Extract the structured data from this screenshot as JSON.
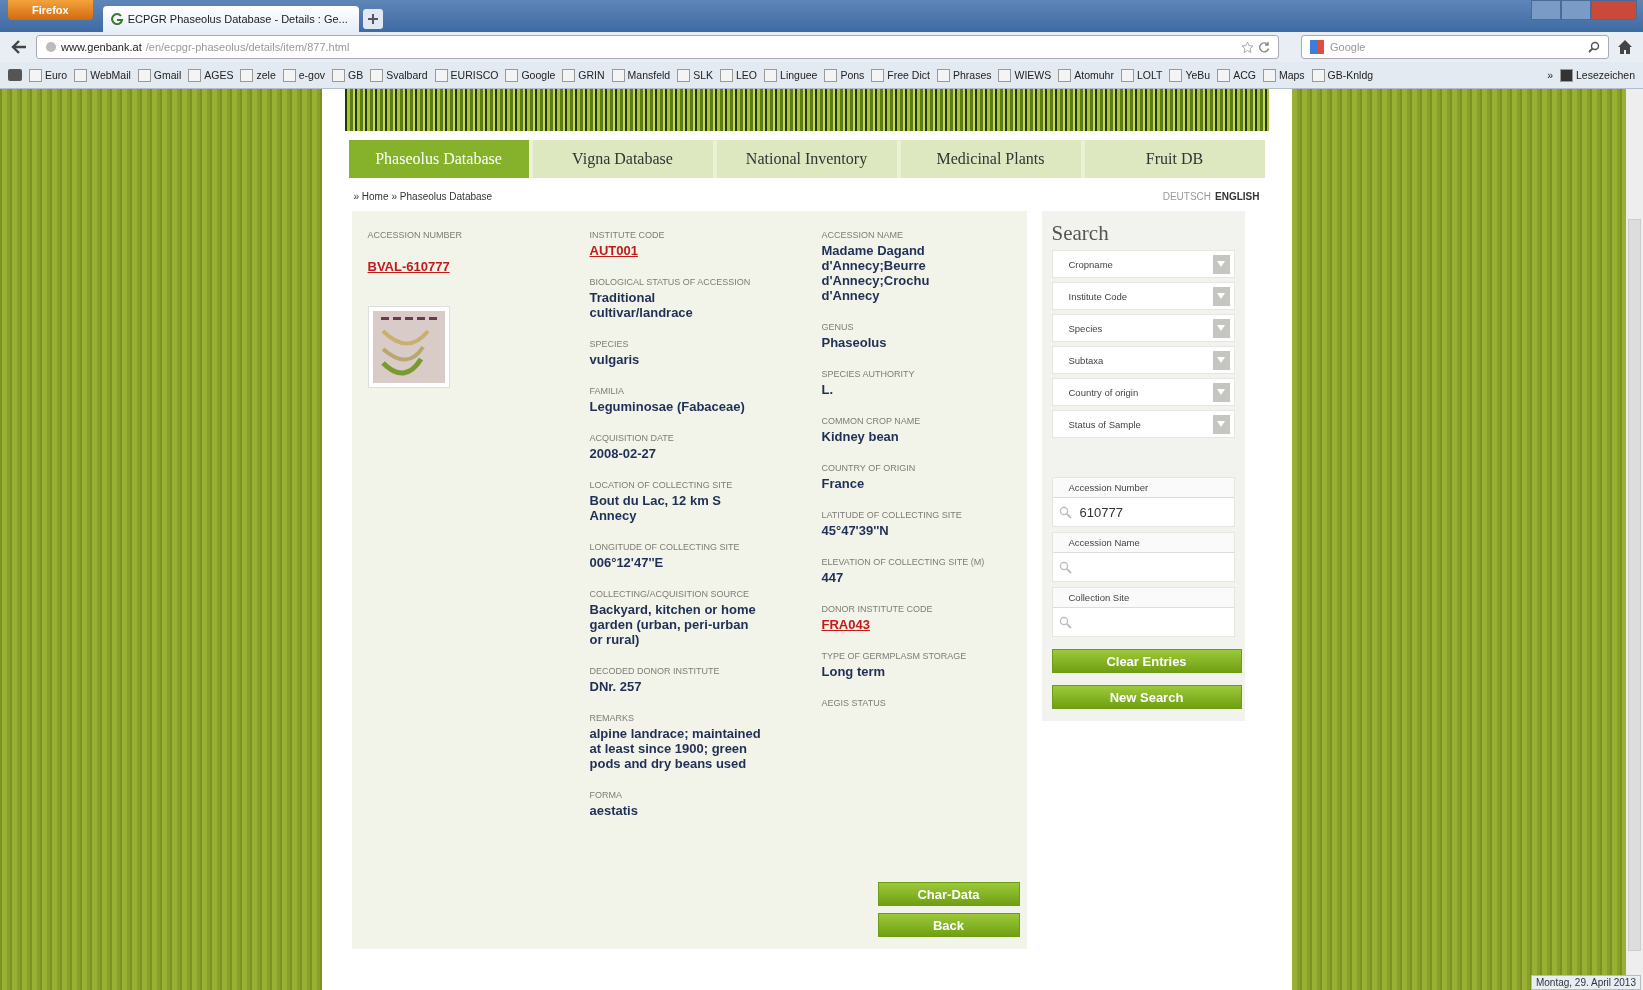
{
  "browser": {
    "menu_button": "Firefox",
    "tab_title": "ECPGR Phaseolus Database - Details : Ge...",
    "url_host": "www.genbank.at",
    "url_path": "/en/ecpgr-phaseolus/details/item/877.html",
    "search_placeholder": "Google",
    "bookmarks": [
      "Euro",
      "WebMail",
      "Gmail",
      "AGES",
      "zele",
      "e-gov",
      "GB",
      "Svalbard",
      "EURISCO",
      "Google",
      "GRIN",
      "Mansfeld",
      "SLK",
      "LEO",
      "Linguee",
      "Pons",
      "Free Dict",
      "Phrases",
      "WIEWS",
      "Atomuhr",
      "LOLT",
      "YeBu",
      "ACG",
      "Maps",
      "GB-Knldg"
    ],
    "bookmarks_overflow": "»",
    "bookmarks_folder": "Lesezeichen"
  },
  "nav_tabs": [
    {
      "label": "Phaseolus Database",
      "selected": true
    },
    {
      "label": "Vigna Database",
      "selected": false
    },
    {
      "label": "National Inventory",
      "selected": false
    },
    {
      "label": "Medicinal Plants",
      "selected": false
    },
    {
      "label": "Fruit DB",
      "selected": false
    }
  ],
  "breadcrumb": [
    "» Home",
    "» Phaseolus Database"
  ],
  "languages": [
    {
      "label": "DEUTSCH",
      "selected": false
    },
    {
      "label": "ENGLISH",
      "selected": true
    }
  ],
  "accession": {
    "label": "ACCESSION NUMBER",
    "value": "BVAL-610777"
  },
  "columns": [
    [
      {
        "label": "INSTITUTE CODE",
        "value": "AUT001",
        "kind": "link"
      },
      {
        "label": "BIOLOGICAL STATUS OF ACCESSION",
        "value": "Traditional cultivar/landrace",
        "kind": "text"
      },
      {
        "label": "SPECIES",
        "value": "vulgaris",
        "kind": "text"
      },
      {
        "label": "FAMILIA",
        "value": "Leguminosae (Fabaceae)",
        "kind": "text"
      },
      {
        "label": "ACQUISITION DATE",
        "value": "2008-02-27",
        "kind": "text"
      },
      {
        "label": "LOCATION OF COLLECTING SITE",
        "value": "Bout du Lac, 12 km S Annecy",
        "kind": "text"
      },
      {
        "label": "LONGITUDE OF COLLECTING SITE",
        "value": "006°12'47''E",
        "kind": "text"
      },
      {
        "label": "COLLECTING/ACQUISITION SOURCE",
        "value": "Backyard, kitchen or home garden (urban, peri-urban or rural)",
        "kind": "text"
      },
      {
        "label": "DECODED DONOR INSTITUTE",
        "value": "DNr. 257",
        "kind": "text"
      },
      {
        "label": "REMARKS",
        "value": "alpine landrace; maintained at least since 1900; green pods and dry beans used",
        "kind": "text"
      },
      {
        "label": "FORMA",
        "value": "aestatis",
        "kind": "text"
      }
    ],
    [
      {
        "label": "ACCESSION NAME",
        "value": "Madame Dagand d'Annecy;Beurre d'Annecy;Crochu d'Annecy",
        "kind": "text"
      },
      {
        "label": "GENUS",
        "value": "Phaseolus",
        "kind": "text"
      },
      {
        "label": "SPECIES AUTHORITY",
        "value": "L.",
        "kind": "text"
      },
      {
        "label": "COMMON CROP NAME",
        "value": "Kidney bean",
        "kind": "text"
      },
      {
        "label": "COUNTRY OF ORIGIN",
        "value": "France",
        "kind": "text"
      },
      {
        "label": "LATITUDE OF COLLECTING SITE",
        "value": "45°47'39''N",
        "kind": "text"
      },
      {
        "label": "ELEVATION OF COLLECTING SITE (M)",
        "value": "447",
        "kind": "text"
      },
      {
        "label": "DONOR INSTITUTE CODE",
        "value": "FRA043",
        "kind": "link"
      },
      {
        "label": "TYPE OF GERMPLASM STORAGE",
        "value": "Long term",
        "kind": "text"
      },
      {
        "label": "AEGIS STATUS"
      }
    ]
  ],
  "actions": [
    "Char-Data",
    "Back"
  ],
  "search": {
    "title": "Search",
    "dropdowns": [
      "Cropname",
      "Institute Code",
      "Species",
      "Subtaxa",
      "Country of origin",
      "Status of Sample"
    ],
    "fields": [
      {
        "label": "Accession Number",
        "value": "610777"
      },
      {
        "label": "Accession Name"
      },
      {
        "label": "Collection Site"
      }
    ],
    "buttons": [
      "Clear Entries",
      "New Search"
    ]
  },
  "clock": "Montag, 29. April 2013"
}
